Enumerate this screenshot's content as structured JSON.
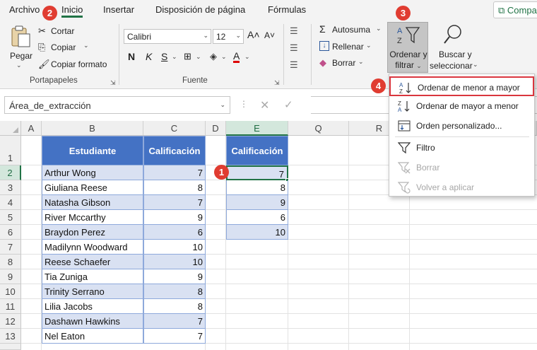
{
  "ribbon_tabs": [
    "Archivo",
    "Inicio",
    "Insertar",
    "Disposición de página",
    "Fórmulas"
  ],
  "share_label": "Compartir",
  "clipboard": {
    "paste": "Pegar",
    "cut": "Cortar",
    "copy": "Copiar",
    "format_painter": "Copiar formato",
    "group": "Portapapeles"
  },
  "font": {
    "name": "Calibri",
    "size": "12",
    "group": "Fuente"
  },
  "editing": {
    "autosum": "Autosuma",
    "fill": "Rellenar",
    "clear": "Borrar",
    "sort_filter_line1": "Ordenar y",
    "sort_filter_line2": "filtrar",
    "find_line1": "Buscar y",
    "find_line2": "seleccionar"
  },
  "name_box": "Área_de_extracción",
  "columns": [
    "A",
    "B",
    "C",
    "D",
    "E",
    "Q",
    "R"
  ],
  "rows": [
    "1",
    "2",
    "3",
    "4",
    "5",
    "6",
    "7",
    "8",
    "9",
    "10",
    "11",
    "12",
    "13"
  ],
  "table": {
    "header_student": "Estudiante",
    "header_grade": "Calificación",
    "rows": [
      {
        "name": "Arthur Wong",
        "grade": "7"
      },
      {
        "name": "Giuliana Reese",
        "grade": "8"
      },
      {
        "name": "Natasha Gibson",
        "grade": "7"
      },
      {
        "name": "River Mccarthy",
        "grade": "9"
      },
      {
        "name": "Braydon Perez",
        "grade": "6"
      },
      {
        "name": "Madilynn Woodward",
        "grade": "10"
      },
      {
        "name": "Reese Schaefer",
        "grade": "10"
      },
      {
        "name": "Tia Zuniga",
        "grade": "9"
      },
      {
        "name": "Trinity Serrano",
        "grade": "8"
      },
      {
        "name": "Lilia Jacobs",
        "grade": "8"
      },
      {
        "name": "Dashawn Hawkins",
        "grade": "7"
      },
      {
        "name": "Nel Eaton",
        "grade": "7"
      }
    ]
  },
  "extract": {
    "header": "Calificación",
    "values": [
      "7",
      "8",
      "9",
      "6",
      "10"
    ]
  },
  "menu": {
    "sort_asc": "Ordenar de menor a mayor",
    "sort_desc": "Ordenar de mayor a menor",
    "custom": "Orden personalizado...",
    "filter": "Filtro",
    "clear": "Borrar",
    "reapply": "Volver a aplicar"
  },
  "badges": [
    "1",
    "2",
    "3",
    "4"
  ],
  "colors": {
    "accent": "#217346",
    "table_header": "#4472c4",
    "band": "#d9e1f2",
    "badge": "#e03c31"
  }
}
